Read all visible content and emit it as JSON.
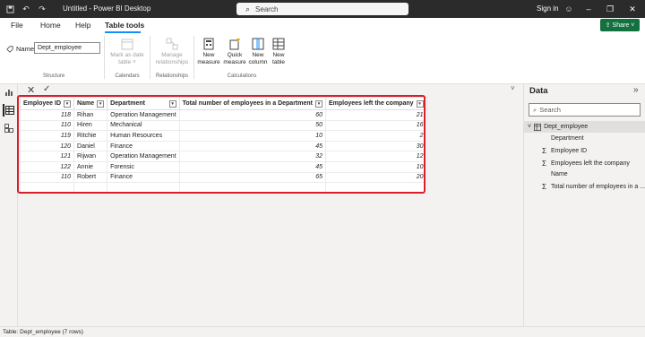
{
  "titlebar": {
    "title": "Untitled - Power BI Desktop",
    "search_placeholder": "Search",
    "signin_label": "Sign in"
  },
  "menu": {
    "tabs": [
      {
        "label": "File"
      },
      {
        "label": "Home"
      },
      {
        "label": "Help"
      },
      {
        "label": "Table tools"
      }
    ],
    "share_label": "Share"
  },
  "ribbon": {
    "name_label": "Name",
    "name_value": "Dept_employee",
    "groups": {
      "structure": "Structure",
      "calendars": "Calendars",
      "relationships": "Relationships",
      "calculations": "Calculations"
    },
    "buttons": {
      "mark_date": [
        "Mark as date",
        "table ˅"
      ],
      "manage_rel": [
        "Manage",
        "relationships"
      ],
      "new_measure": [
        "New",
        "measure"
      ],
      "quick_measure": [
        "Quick",
        "measure"
      ],
      "new_column": [
        "New",
        "column"
      ],
      "new_table": [
        "New",
        "table"
      ]
    }
  },
  "table": {
    "columns": [
      "Employee ID",
      "Name",
      "Department",
      "Total number of employees in a Department",
      "Employees left the company"
    ],
    "rows": [
      [
        "118",
        "Rihan",
        "Operation Management",
        "60",
        "21"
      ],
      [
        "110",
        "Hiren",
        "Mechanical",
        "50",
        "16"
      ],
      [
        "119",
        "Ritchie",
        "Human Resources",
        "10",
        "2"
      ],
      [
        "120",
        "Daniel",
        "Finance",
        "45",
        "30"
      ],
      [
        "121",
        "Rijwan",
        "Operation Management",
        "32",
        "12"
      ],
      [
        "122",
        "Annie",
        "Forensic",
        "45",
        "10"
      ],
      [
        "110",
        "Robert",
        "Finance",
        "65",
        "20"
      ]
    ]
  },
  "datapane": {
    "title": "Data",
    "search_placeholder": "Search",
    "table_name": "Dept_employee",
    "fields": [
      {
        "label": "Department",
        "sigma": false
      },
      {
        "label": "Employee ID",
        "sigma": true
      },
      {
        "label": "Employees left the company",
        "sigma": true
      },
      {
        "label": "Name",
        "sigma": false
      },
      {
        "label": "Total number of employees in a ...",
        "sigma": true
      }
    ]
  },
  "status": {
    "text": "Table: Dept_employee (7 rows)"
  },
  "colors": {
    "accent": "#118dff",
    "share": "#13703f",
    "highlight": "#d71f2b"
  }
}
